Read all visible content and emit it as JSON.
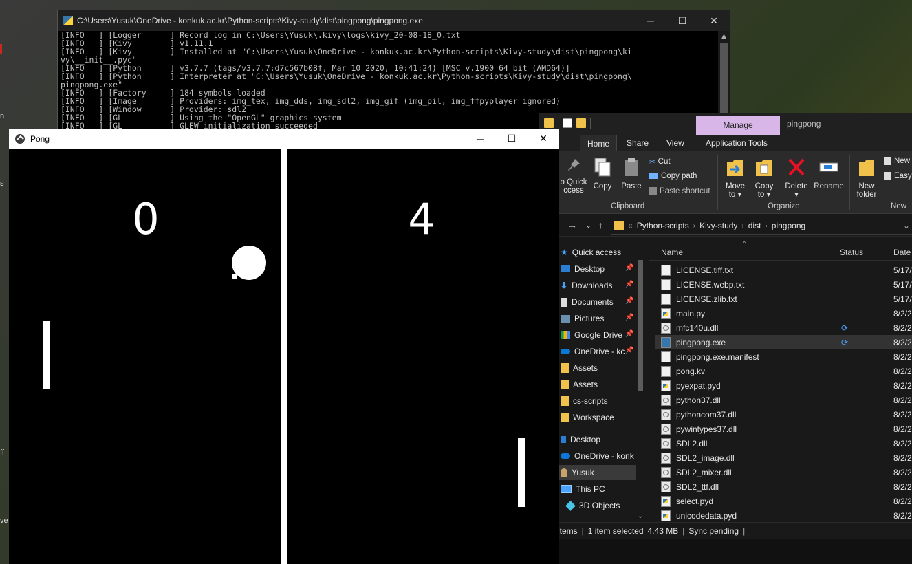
{
  "desktop": {
    "fragments": [
      "n",
      "s",
      "ff",
      "ve"
    ]
  },
  "console": {
    "title": "C:\\Users\\Yusuk\\OneDrive - konkuk.ac.kr\\Python-scripts\\Kivy-study\\dist\\pingpong\\pingpong.exe",
    "minimize": "─",
    "maximize": "☐",
    "close": "✕",
    "lines": [
      "[INFO   ] [Logger      ] Record log in C:\\Users\\Yusuk\\.kivy\\logs\\kivy_20-08-18_0.txt",
      "[INFO   ] [Kivy        ] v1.11.1",
      "[INFO   ] [Kivy        ] Installed at \"C:\\Users\\Yusuk\\OneDrive - konkuk.ac.kr\\Python-scripts\\Kivy-study\\dist\\pingpong\\ki",
      "vy\\__init__.pyc\"",
      "[INFO   ] [Python      ] v3.7.7 (tags/v3.7.7:d7c567b08f, Mar 10 2020, 10:41:24) [MSC v.1900 64 bit (AMD64)]",
      "[INFO   ] [Python      ] Interpreter at \"C:\\Users\\Yusuk\\OneDrive - konkuk.ac.kr\\Python-scripts\\Kivy-study\\dist\\pingpong\\",
      "pingpong.exe\"",
      "[INFO   ] [Factory     ] 184 symbols loaded",
      "[INFO   ] [Image       ] Providers: img_tex, img_dds, img_sdl2, img_gif (img_pil, img_ffpyplayer ignored)",
      "[INFO   ] [Window      ] Provider: sdl2",
      "[INFO   ] [GL          ] Using the \"OpenGL\" graphics system",
      "[INFO   ] [GL          ] GLEW initialization succeeded"
    ],
    "scroll_up": "▲"
  },
  "pong": {
    "title": "Pong",
    "minimize": "─",
    "maximize": "☐",
    "close": "✕",
    "score_left": "0",
    "score_right": "4"
  },
  "explorer": {
    "manage_tab": "Manage",
    "window_title": "pingpong",
    "ribbon_tabs": {
      "file": "e",
      "home": "Home",
      "share": "Share",
      "view": "View",
      "app_tools": "Application Tools"
    },
    "ribbon": {
      "pin_quick_access_line1": "o Quick",
      "pin_quick_access_line2": "ccess",
      "copy": "Copy",
      "paste": "Paste",
      "cut": "Cut",
      "copy_path": "Copy path",
      "paste_shortcut": "Paste shortcut",
      "group_clipboard": "Clipboard",
      "move_to_line1": "Move",
      "move_to_line2": "to ▾",
      "copy_to_line1": "Copy",
      "copy_to_line2": "to ▾",
      "delete_line1": "Delete",
      "delete_line2": "▾",
      "rename": "Rename",
      "group_organize": "Organize",
      "new_folder_line1": "New",
      "new_folder_line2": "folder",
      "new_item": "New",
      "easy_access": "Easy",
      "group_new": "New"
    },
    "address": {
      "back": "→",
      "recent": "⌄",
      "up": "↑",
      "overflow": "«",
      "crumbs": [
        "Python-scripts",
        "Kivy-study",
        "dist",
        "pingpong"
      ],
      "sep": "›",
      "dropdown": "⌄"
    },
    "nav": [
      {
        "label": "Quick access",
        "icon": "star-icon",
        "pinned": false
      },
      {
        "label": "Desktop",
        "icon": "desktop-icon",
        "pinned": true
      },
      {
        "label": "Downloads",
        "icon": "download-icon",
        "pinned": true
      },
      {
        "label": "Documents",
        "icon": "document-icon",
        "pinned": true
      },
      {
        "label": "Pictures",
        "icon": "picture-icon",
        "pinned": true
      },
      {
        "label": "Google Drive",
        "icon": "google-drive-icon",
        "pinned": true
      },
      {
        "label": "OneDrive - kc",
        "icon": "onedrive-icon",
        "pinned": true
      },
      {
        "label": "Assets",
        "icon": "folder-icon",
        "pinned": false
      },
      {
        "label": "Assets",
        "icon": "folder-icon",
        "pinned": false
      },
      {
        "label": "cs-scripts",
        "icon": "folder-icon",
        "pinned": false
      },
      {
        "label": "Workspace",
        "icon": "folder-icon",
        "pinned": false
      },
      {
        "label": "Desktop",
        "icon": "desktop-icon",
        "pinned": false
      },
      {
        "label": "OneDrive - konk",
        "icon": "onedrive-icon",
        "pinned": false
      },
      {
        "label": "Yusuk",
        "icon": "user-icon",
        "pinned": false
      },
      {
        "label": "This PC",
        "icon": "pc-icon",
        "pinned": false
      },
      {
        "label": "3D Objects",
        "icon": "cube-icon",
        "pinned": false
      }
    ],
    "pin_glyph": "📌",
    "columns": {
      "name": "Name",
      "status": "Status",
      "date": "Date"
    },
    "sort_glyph": "^",
    "files": [
      {
        "name": "LICENSE.tiff.txt",
        "type": "txt",
        "sync": "",
        "date": "5/17/"
      },
      {
        "name": "LICENSE.webp.txt",
        "type": "txt",
        "sync": "",
        "date": "5/17/"
      },
      {
        "name": "LICENSE.zlib.txt",
        "type": "txt",
        "sync": "",
        "date": "5/17/"
      },
      {
        "name": "main.py",
        "type": "py",
        "sync": "",
        "date": "8/2/2"
      },
      {
        "name": "mfc140u.dll",
        "type": "dll",
        "sync": "⟳",
        "date": "8/2/2"
      },
      {
        "name": "pingpong.exe",
        "type": "exe",
        "sync": "⟳",
        "date": "8/2/2"
      },
      {
        "name": "pingpong.exe.manifest",
        "type": "txt",
        "sync": "",
        "date": "8/2/2"
      },
      {
        "name": "pong.kv",
        "type": "txt",
        "sync": "",
        "date": "8/2/2"
      },
      {
        "name": "pyexpat.pyd",
        "type": "py",
        "sync": "",
        "date": "8/2/2"
      },
      {
        "name": "python37.dll",
        "type": "dll",
        "sync": "",
        "date": "8/2/2"
      },
      {
        "name": "pythoncom37.dll",
        "type": "dll",
        "sync": "",
        "date": "8/2/2"
      },
      {
        "name": "pywintypes37.dll",
        "type": "dll",
        "sync": "",
        "date": "8/2/2"
      },
      {
        "name": "SDL2.dll",
        "type": "dll",
        "sync": "",
        "date": "8/2/2"
      },
      {
        "name": "SDL2_image.dll",
        "type": "dll",
        "sync": "",
        "date": "8/2/2"
      },
      {
        "name": "SDL2_mixer.dll",
        "type": "dll",
        "sync": "",
        "date": "8/2/2"
      },
      {
        "name": "SDL2_ttf.dll",
        "type": "dll",
        "sync": "",
        "date": "8/2/2"
      },
      {
        "name": "select.pyd",
        "type": "py",
        "sync": "",
        "date": "8/2/2"
      },
      {
        "name": "unicodedata.pyd",
        "type": "py",
        "sync": "",
        "date": "8/2/2"
      }
    ],
    "status": {
      "items": "items",
      "selected": "1 item selected",
      "size": "4.43 MB",
      "sync": "Sync pending",
      "bar": "|"
    },
    "nav_scroll_down": "⌄"
  }
}
